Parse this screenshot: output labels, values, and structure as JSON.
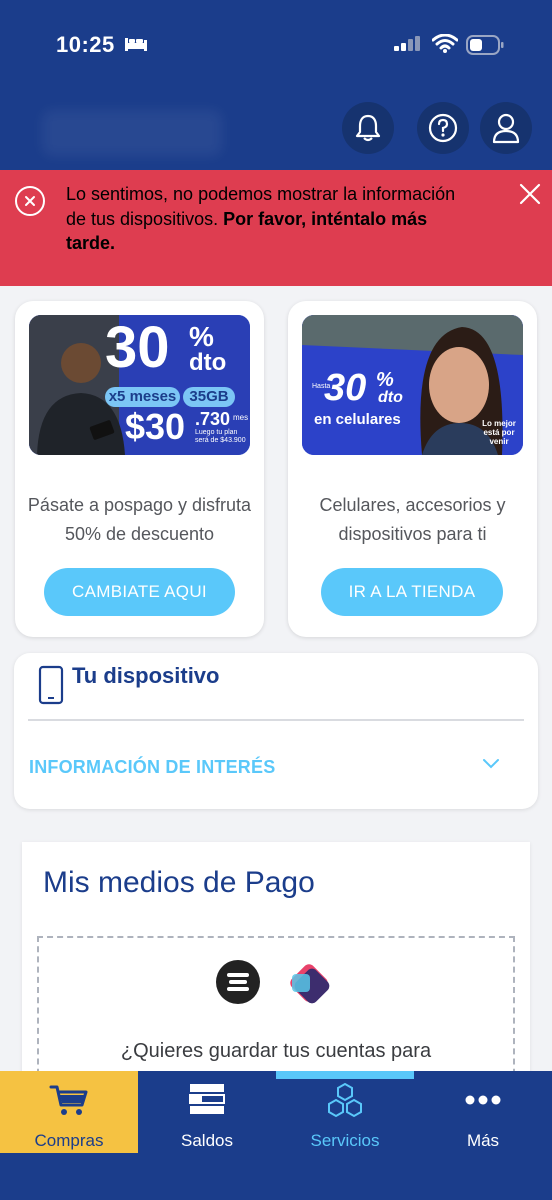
{
  "status_bar": {
    "time": "10:25"
  },
  "header": {
    "icons": [
      "bell-icon",
      "help-icon",
      "user-icon"
    ]
  },
  "alert": {
    "text_normal": "Lo sentimos, no podemos mostrar la información de tus dispositivos. ",
    "text_bold": "Por favor, inténtalo más tarde."
  },
  "promos": [
    {
      "banner": {
        "pct": "30",
        "sym": "%",
        "dto": "dto",
        "months": "x5 meses",
        "gb": "35GB",
        "price": "$30",
        "cents": ".730",
        "small": "Luego tu plan será de $43.900",
        "per": "mes"
      },
      "description": "Pásate a pospago y disfruta 50% de descuento",
      "button": "CAMBIATE AQUI"
    },
    {
      "banner": {
        "hasta": "Hasta",
        "pct": "30",
        "sym": "%",
        "dto": "dto",
        "label": "en celulares",
        "tagline": "Lo mejor está por venir"
      },
      "description": "Celulares, accesorios y dispositivos para ti",
      "button": "IR A LA TIENDA"
    }
  ],
  "device": {
    "title": "Tu dispositivo",
    "info_label": "INFORMACIÓN DE INTERÉS"
  },
  "payment": {
    "title": "Mis medios de Pago",
    "text": "¿Quieres guardar tus cuentas para"
  },
  "bottom_nav": [
    {
      "label": "Compras",
      "icon": "cart-icon",
      "active": true
    },
    {
      "label": "Saldos",
      "icon": "stack-icon"
    },
    {
      "label": "Servicios",
      "icon": "hexagons-icon"
    },
    {
      "label": "Más",
      "icon": "more-dots-icon"
    }
  ],
  "colors": {
    "header": "#1b3d8b",
    "alert": "#de3d50",
    "accent": "#5ac8fa",
    "active_tab": "#f5c242"
  }
}
